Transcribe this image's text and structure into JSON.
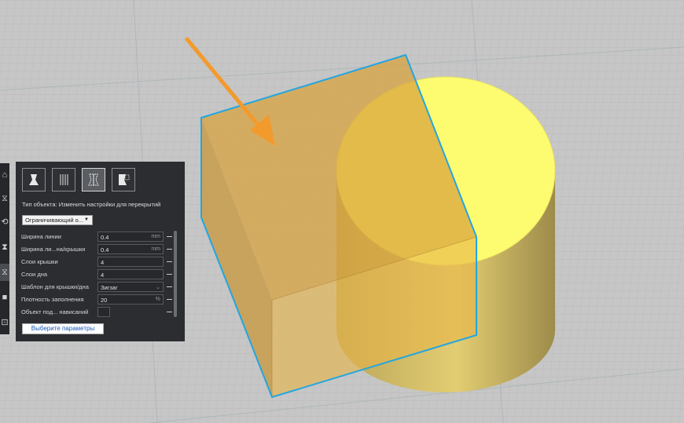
{
  "colors": {
    "background_grid": "#c4c4c4",
    "panel_bg": "#2b2d31",
    "cube_fill": "#e0a83a",
    "cube_outline": "#22a6e0",
    "cylinder_top": "#fdfb70",
    "cylinder_side": "#cbb25c",
    "arrow": "#f39a2c"
  },
  "toolstrip": {
    "icons": [
      "move-icon",
      "scale-icon",
      "rotate-icon",
      "mirror-icon",
      "per-model-settings-icon",
      "support-blocker-icon",
      "tool-icon"
    ]
  },
  "panel": {
    "mesh_type_buttons": [
      "normal-model-icon",
      "print-as-support-icon",
      "modify-overlap-settings-icon",
      "anti-overhang-mesh-icon"
    ],
    "type_label": "Тип объекта: Изменить настройки для перекрытий",
    "dropdown_value": "Ограничивающий о...",
    "settings": [
      {
        "label": "Ширина линии",
        "value": "0.4",
        "unit": "mm"
      },
      {
        "label": "Ширина ли...на/крышки",
        "value": "0.4",
        "unit": "mm"
      },
      {
        "label": "Слои крышки",
        "value": "4",
        "unit": ""
      },
      {
        "label": "Слои дна",
        "value": "4",
        "unit": ""
      },
      {
        "label": "Шаблон для крышки/дна",
        "value": "Зигзаг",
        "unit": ""
      },
      {
        "label": "Плотность заполнения",
        "value": "20",
        "unit": "%"
      },
      {
        "label": "Объект под... нависаний",
        "value": "",
        "unit": ""
      }
    ],
    "select_button_label": "Выберите параметры"
  }
}
